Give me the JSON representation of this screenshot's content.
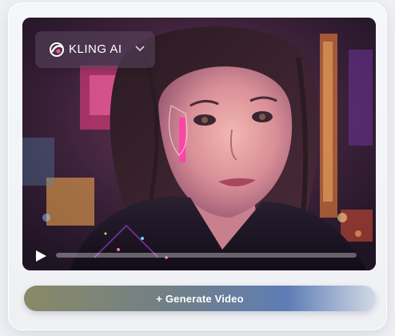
{
  "brand": {
    "name": "KLING AI",
    "logo_icon": "kling-logo-icon",
    "menu_icon": "chevron-down-icon"
  },
  "player": {
    "play_icon": "play-icon",
    "progress": 0.0
  },
  "actions": {
    "generate_label": "+ Generate Video"
  },
  "colors": {
    "neon_pink": "#ff3fa8",
    "neon_orange": "#ff8a3a",
    "button_start": "#8a8967",
    "button_end": "#5e7db6"
  }
}
